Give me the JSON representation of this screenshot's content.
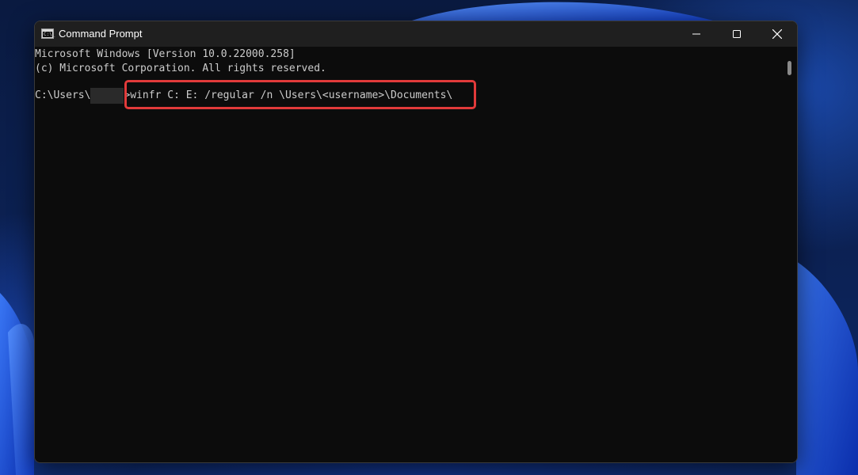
{
  "window": {
    "title": "Command Prompt",
    "icon": "cmd-icon",
    "icon_text": "C:\\_",
    "controls": [
      "minimize-icon",
      "maximize-icon",
      "close-icon"
    ]
  },
  "console": {
    "line1": "Microsoft Windows [Version 10.0.22000.258]",
    "line2": "(c) Microsoft Corporation. All rights reserved.",
    "prompt_prefix": "C:\\Users\\",
    "prompt_suffix": ">",
    "command": "winfr C: E: /regular /n \\Users\\<username>\\Documents\\"
  },
  "colors": {
    "highlight": "#e23a3a",
    "console_bg": "#0c0c0c",
    "console_text": "#cccccc"
  }
}
